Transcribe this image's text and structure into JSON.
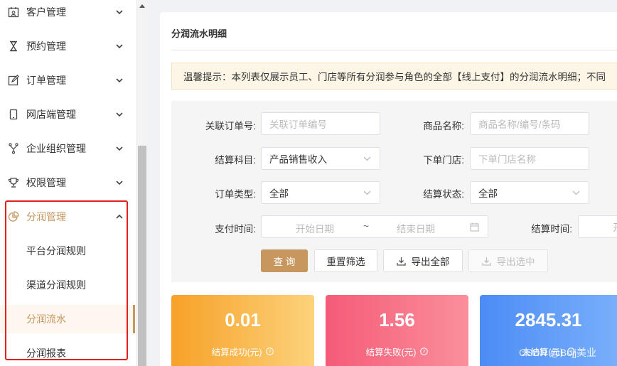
{
  "sidebar": {
    "items": [
      {
        "label": "客户管理",
        "icon": "calendar-user-icon"
      },
      {
        "label": "预约管理",
        "icon": "hourglass-icon"
      },
      {
        "label": "订单管理",
        "icon": "edit-icon"
      },
      {
        "label": "网店端管理",
        "icon": "mobile-icon"
      },
      {
        "label": "企业组织管理",
        "icon": "org-icon"
      },
      {
        "label": "权限管理",
        "icon": "trophy-icon"
      },
      {
        "label": "分润管理",
        "icon": "pie-chart-icon",
        "active": true
      }
    ],
    "subitems": [
      {
        "label": "平台分润规则"
      },
      {
        "label": "渠道分润规则"
      },
      {
        "label": "分润流水",
        "selected": true
      },
      {
        "label": "分润报表"
      }
    ]
  },
  "panel": {
    "title": "分润流水明细",
    "tip": "温馨提示：本列表仅展示员工、门店等所有分润参与角色的全部【线上支付】的分润流水明细；不同"
  },
  "filters": {
    "order_no": {
      "label": "关联订单号:",
      "placeholder": "关联订单编号"
    },
    "product": {
      "label": "商品名称:",
      "placeholder": "商品名称/编号/条码"
    },
    "subject": {
      "label": "结算科目:",
      "value": "产品销售收入"
    },
    "store": {
      "label": "下单门店:",
      "placeholder": "下单门店名称"
    },
    "order_type": {
      "label": "订单类型:",
      "value": "全部"
    },
    "settle_status": {
      "label": "结算状态:",
      "value": "全部"
    },
    "pay_time": {
      "label": "支付时间:",
      "start": "开始日期",
      "sep": "~",
      "end": "结束日期"
    },
    "settle_time": {
      "label": "结算时间:",
      "placeholder": "开"
    }
  },
  "buttons": {
    "query": "查 询",
    "reset": "重置筛选",
    "export_all": "导出全部",
    "export_selected": "导出选中"
  },
  "cards": [
    {
      "value": "0.01",
      "caption": "结算成功(元)"
    },
    {
      "value": "1.56",
      "caption": "结算失败(元)"
    },
    {
      "value": "2845.31",
      "caption": "未结算(元)"
    }
  ],
  "watermark": "CSDN @Bojj美业",
  "colors": {
    "accent": "#c8965f",
    "highlight": "#e0201c"
  }
}
